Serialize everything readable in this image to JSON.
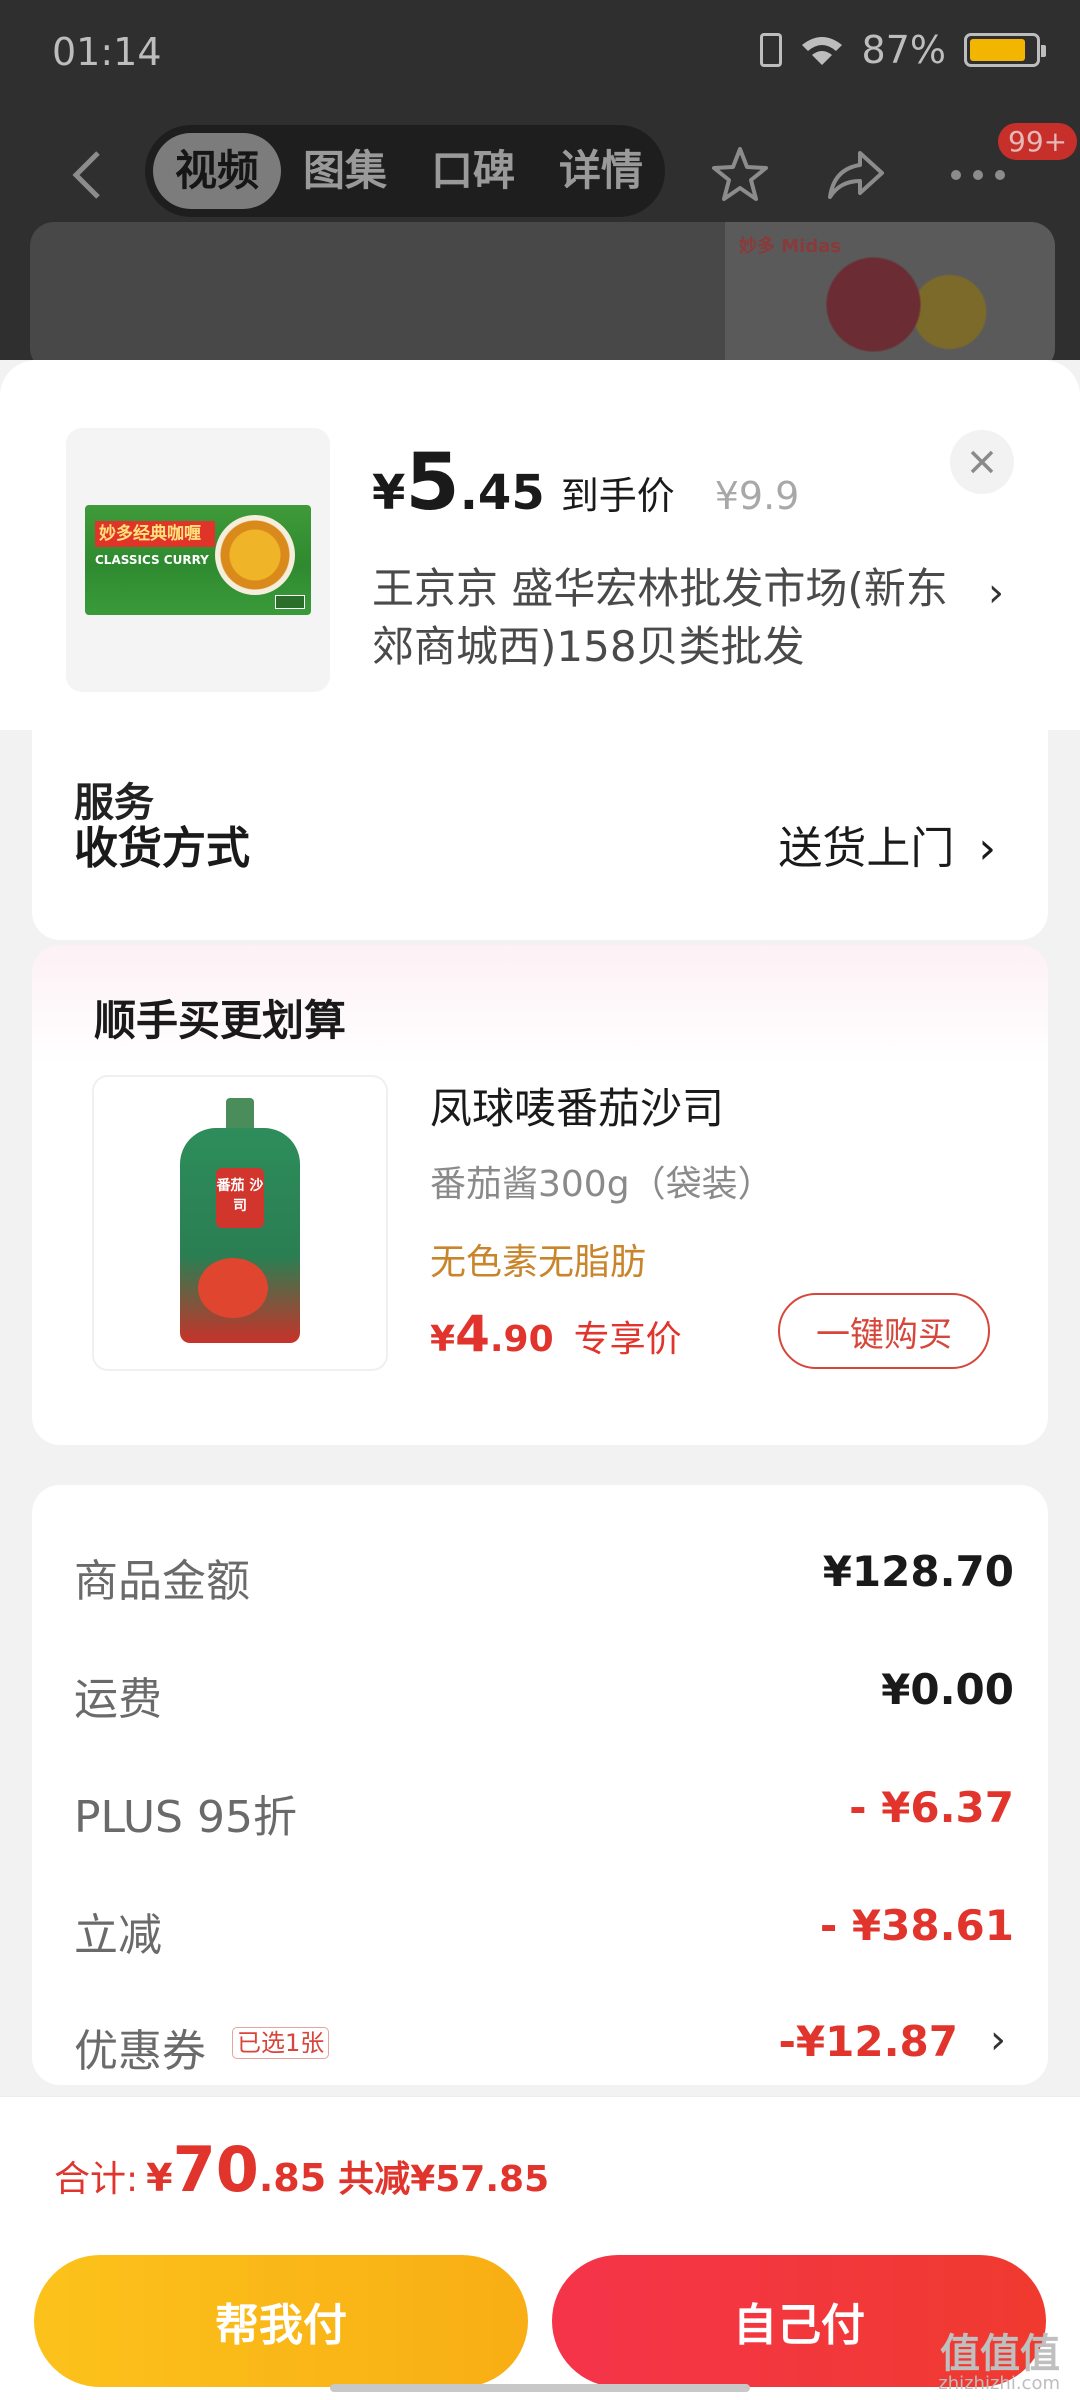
{
  "status_bar": {
    "time": "01:14",
    "battery": "87%"
  },
  "background_nav": {
    "tabs": [
      {
        "label": "视频",
        "active": true
      },
      {
        "label": "图集",
        "active": false
      },
      {
        "label": "口碑",
        "active": false
      },
      {
        "label": "详情",
        "active": false
      }
    ],
    "badge": "99+",
    "banner_logo": "妙多 Midas"
  },
  "product": {
    "price_symbol": "¥",
    "price_int": "5",
    "price_dec": ".45",
    "price_label": "到手价",
    "original_price": "¥9.9",
    "address": "王京京  盛华宏林批发市场(新东郊商城西)158贝类批发",
    "thumbnail": {
      "brand": "妙多经典咖喱",
      "sub": "CLASSICS CURRY"
    }
  },
  "delivery": {
    "clipped_text": "服务",
    "label": "收货方式",
    "value": "送货上门"
  },
  "upsell": {
    "title": "顺手买更划算",
    "product_name": "凤球唛番茄沙司",
    "spec": "番茄酱300g（袋装）",
    "feature": "无色素无脂肪",
    "price_symbol": "¥",
    "price_int": "4",
    "price_dec": ".90",
    "price_label": "专享价",
    "buy_label": "一键购买",
    "thumbnail_text": "番茄 沙司"
  },
  "summary": {
    "rows": [
      {
        "label": "商品金额",
        "value": "¥128.70"
      },
      {
        "label": "运费",
        "value": "¥0.00"
      },
      {
        "label": "PLUS 95折",
        "value": "- ¥6.37"
      },
      {
        "label": "立减",
        "value": "- ¥38.61"
      },
      {
        "label": "优惠券",
        "value": "-¥12.87",
        "tag": "已选1张"
      }
    ]
  },
  "checkout": {
    "total_label": "合计:",
    "total_symbol": "¥",
    "total_int": "70",
    "total_dec": ".85",
    "total_reduce": "共减¥57.85",
    "help_pay_label": "帮我付",
    "self_pay_label": "自己付"
  },
  "watermark": {
    "text": "值值值",
    "sub": "zhizhizhi.com"
  },
  "colors": {
    "accent_red": "#e0342c",
    "help_pay_yellow": "#fcc21b",
    "self_pay_red": "#f5344a",
    "feature_orange": "#c9852b"
  }
}
